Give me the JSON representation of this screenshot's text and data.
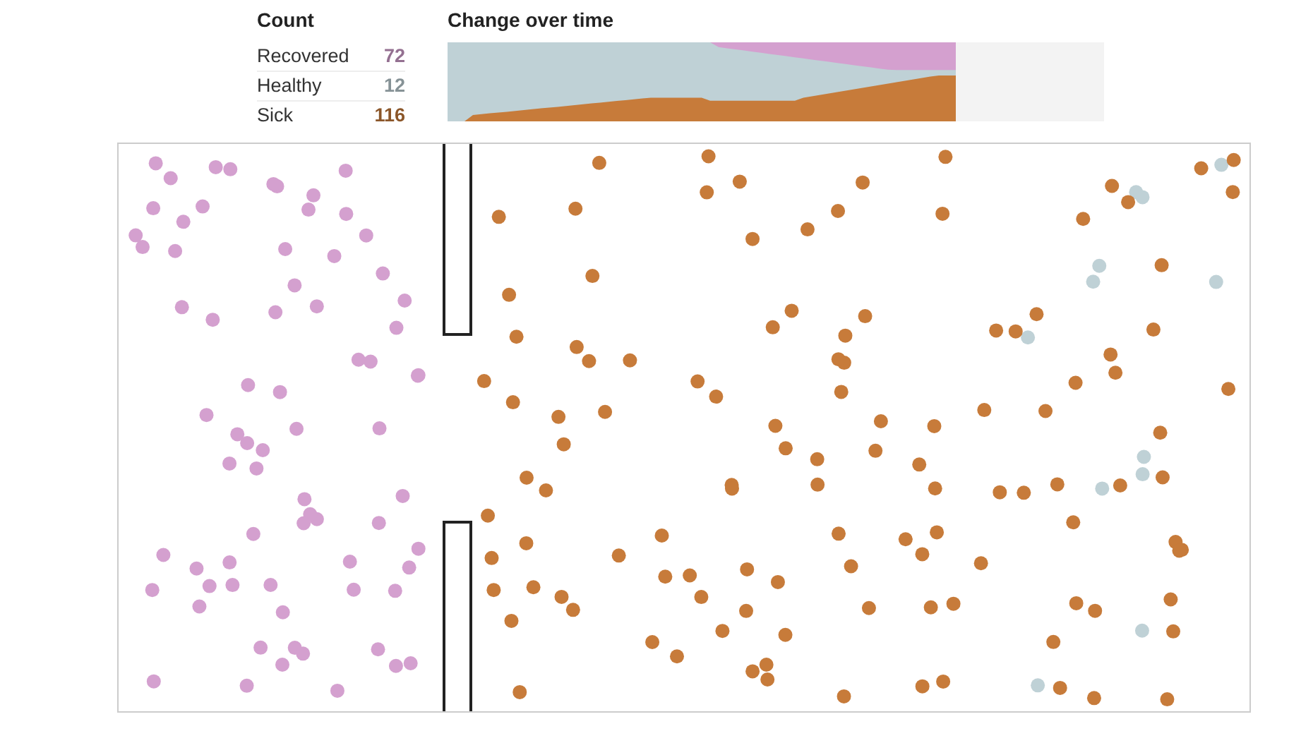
{
  "counts": {
    "title": "Count",
    "items": [
      {
        "label": "Recovered",
        "value": "72",
        "color": "#d4a0cf"
      },
      {
        "label": "Healthy",
        "value": "12",
        "color": "#bfd1d6"
      },
      {
        "label": "Sick",
        "value": "116",
        "color": "#c77b3a"
      }
    ]
  },
  "chart": {
    "title": "Change over time"
  }
}
